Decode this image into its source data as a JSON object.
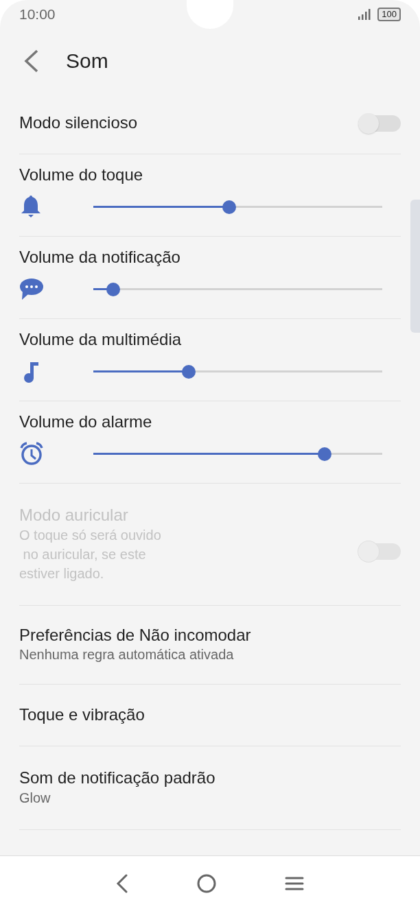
{
  "status_bar": {
    "time": "10:00",
    "battery": "100"
  },
  "header": {
    "title": "Som"
  },
  "items": [
    {
      "kind": "toggle",
      "title": "Modo silencioso",
      "on": false,
      "disabled": false
    },
    {
      "kind": "slider",
      "title": "Volume do toque",
      "level": 0.47
    },
    {
      "kind": "slider",
      "title": "Volume da notificação",
      "level": 0.07
    },
    {
      "kind": "slider",
      "title": "Volume da multimédia",
      "level": 0.33
    },
    {
      "kind": "slider",
      "title": "Volume do alarme",
      "level": 0.8
    },
    {
      "kind": "toggle",
      "title": "Modo auricular",
      "subtitle": "O toque só será ouvido\n no auricular, se este\nestiver ligado.",
      "on": false,
      "disabled": true
    },
    {
      "kind": "link",
      "title": "Preferências de Não incomodar",
      "subtitle": "Nenhuma regra automática ativada"
    },
    {
      "kind": "link",
      "title": "Toque e vibração"
    },
    {
      "kind": "link",
      "title": "Som de notificação padrão",
      "subtitle": "Glow"
    }
  ]
}
